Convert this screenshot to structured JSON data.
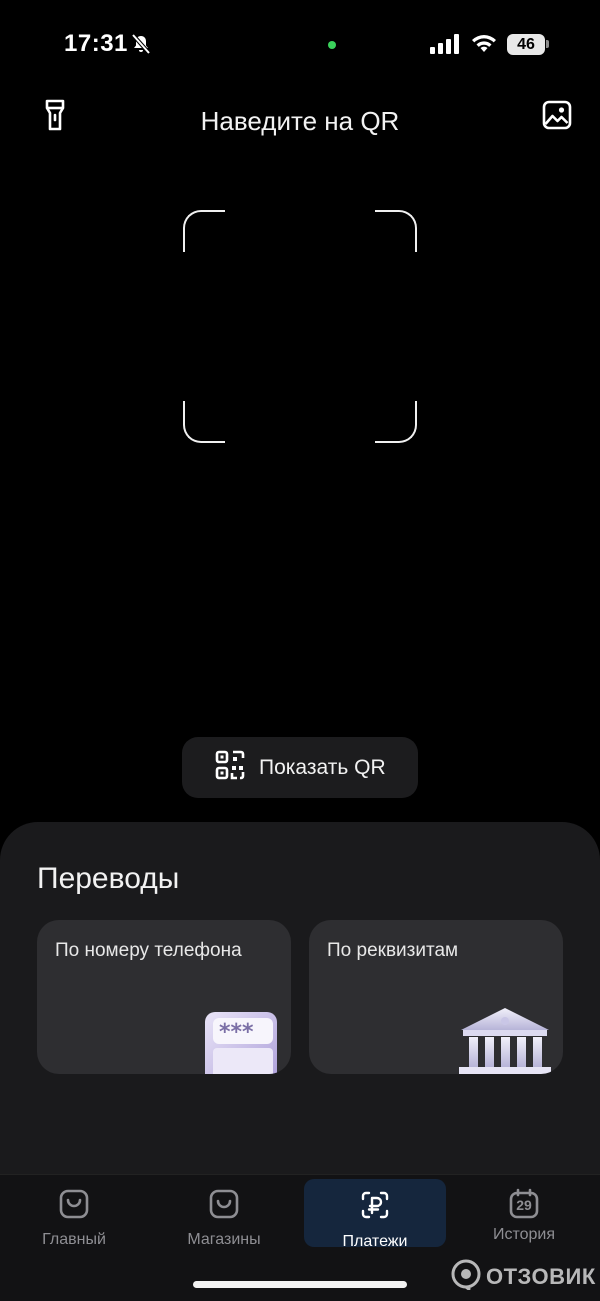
{
  "status_bar": {
    "time": "17:31",
    "battery": "46",
    "indicator_color": "#3ad15b"
  },
  "header": {
    "title": "Наведите на QR",
    "left_icon": "flashlight-icon",
    "right_icon": "gallery-icon"
  },
  "scanner": {
    "show_qr_label": "Показать QR",
    "show_qr_icon": "qr-code-icon"
  },
  "transfers": {
    "title": "Переводы",
    "cards": [
      {
        "label": "По номеру телефона",
        "icon": "phone-illustration"
      },
      {
        "label": "По реквизитам",
        "icon": "bank-illustration"
      }
    ]
  },
  "tabbar": {
    "active_color": "#15263d",
    "tabs": [
      {
        "label": "Главный",
        "icon": "bag-icon",
        "active": false
      },
      {
        "label": "Магазины",
        "icon": "shop-bag-icon",
        "active": false
      },
      {
        "label": "Платежи",
        "icon": "ruble-icon",
        "active": true
      },
      {
        "label": "История",
        "icon": "calendar-icon",
        "badge": "29",
        "active": false
      }
    ]
  },
  "watermark": {
    "text": "ОТЗОВИК"
  }
}
